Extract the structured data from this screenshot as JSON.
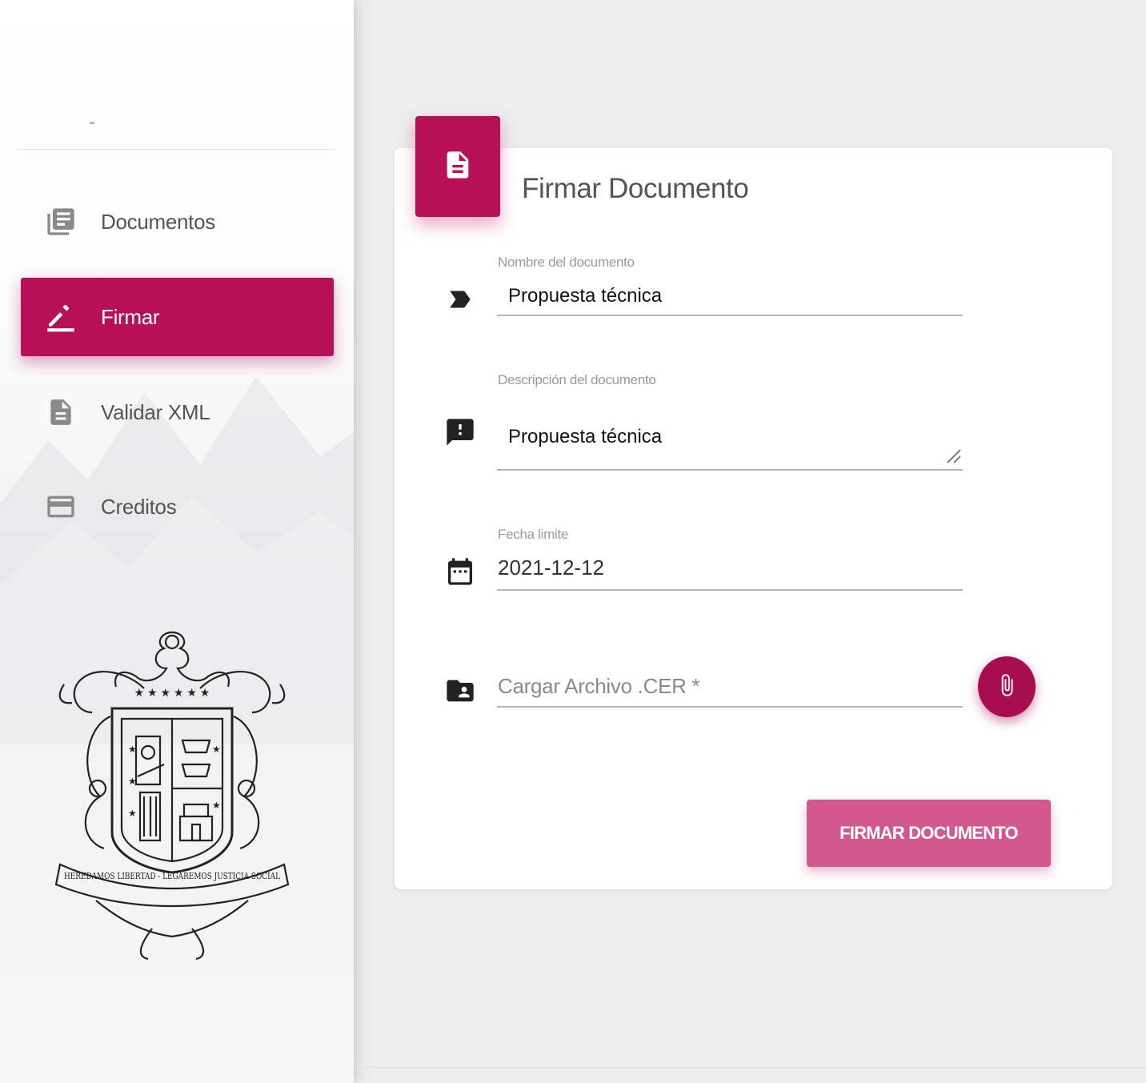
{
  "sidebar": {
    "items": [
      {
        "label": "Documentos",
        "icon": "library-books-icon",
        "active": false
      },
      {
        "label": "Firmar",
        "icon": "edit-pencil-icon",
        "active": true
      },
      {
        "label": "Validar XML",
        "icon": "description-icon",
        "active": false
      },
      {
        "label": "Creditos",
        "icon": "credit-card-icon",
        "active": false
      }
    ],
    "crest_motto": "HEREDAMOS LIBERTAD - LEGAREMOS JUSTICIA SOCIAL"
  },
  "card": {
    "title": "Firmar Documento",
    "header_icon": "description-icon",
    "fields": {
      "nombre": {
        "label": "Nombre del documento",
        "value": "Propuesta técnica",
        "icon": "label-icon"
      },
      "descripcion": {
        "label": "Descripción del documento",
        "value": "Propuesta técnica",
        "icon": "feedback-icon"
      },
      "fecha": {
        "label": "Fecha limite",
        "value": "2021-12-12",
        "icon": "calendar-icon"
      },
      "cer": {
        "placeholder": "Cargar Archivo .CER *",
        "icon": "contact-folder-icon"
      }
    },
    "attach_icon": "paperclip-icon",
    "submit_label": "FIRMAR DOCUMENTO"
  },
  "colors": {
    "accent": "#b80f59",
    "accent_light": "#d2588f",
    "background": "#ededed"
  }
}
